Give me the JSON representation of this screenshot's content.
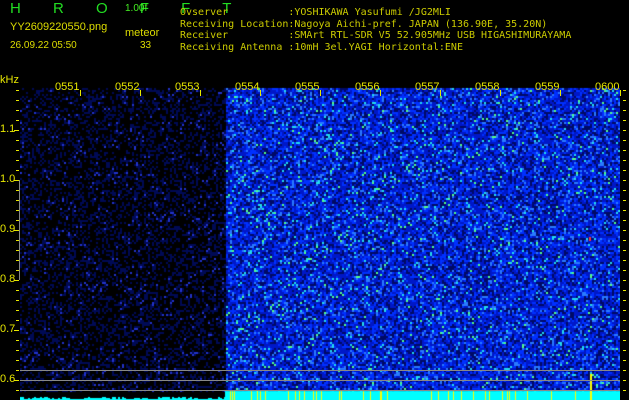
{
  "header": {
    "app_title": "H R O F F T",
    "version": "1.00f",
    "filename": "YY2609220550.png",
    "datetime": "26.09.22 05:50",
    "mode_label": "meteor",
    "count": "33"
  },
  "info": [
    {
      "label": "Ovserver          ",
      "value": ":YOSHIKAWA Yasufumi /JG2MLI"
    },
    {
      "label": "Receiving Location",
      "value": ":Nagoya Aichi-pref. JAPAN (136.90E, 35.20N)"
    },
    {
      "label": "Receiver          ",
      "value": ":SMArt RTL-SDR V5 52.905MHz USB HIGASHIMURAYAMA"
    },
    {
      "label": "Receiving Antenna ",
      "value": ":10mH 3el.YAGI Horizontal:ENE"
    }
  ],
  "spectrogram": {
    "freq_unit": "kHz",
    "freq_ticks": [
      "1.1",
      "1.0",
      "0.9",
      "0.8",
      "0.7",
      "0.6"
    ],
    "time_labels": [
      "0551",
      "0552",
      "0553",
      "0554",
      "0555",
      "0556",
      "0557",
      "0558",
      "0559",
      "0600"
    ],
    "colors": {
      "text": "#e8e800",
      "noise": "#0022ee",
      "level_bar": "#00ffff",
      "meteor_mark": "#ffff00"
    }
  }
}
